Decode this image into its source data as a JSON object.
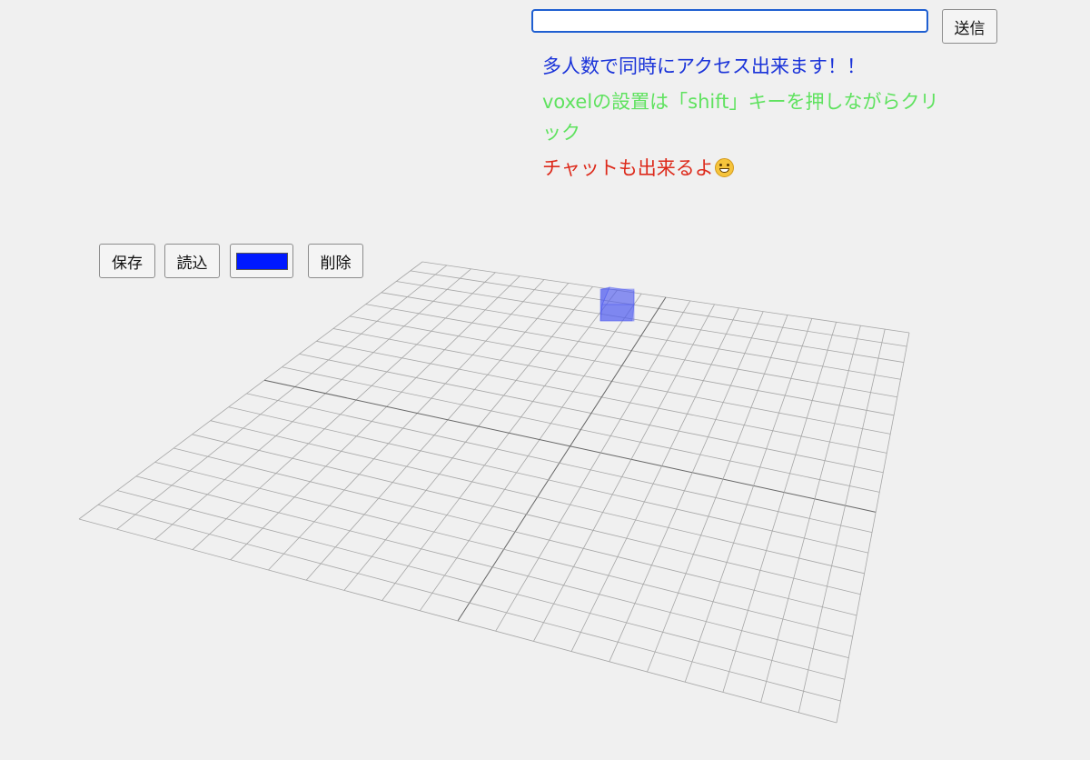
{
  "chat": {
    "input_value": "",
    "send_label": "送信",
    "messages": [
      {
        "text": "多人数で同時にアクセス出来ます！！",
        "color": "#1a33d9"
      },
      {
        "text": "voxelの設置は「shift」キーを押しながらクリック",
        "color": "#5fe25f"
      },
      {
        "text": "チャットも出来るよ",
        "color": "#dd2a1b",
        "icon": "grinning-face-emoji-icon"
      }
    ]
  },
  "toolbar": {
    "save_label": "保存",
    "load_label": "読込",
    "color_value": "#0019ff",
    "delete_label": "削除"
  },
  "scene": {
    "grid_divisions": 20,
    "grid_line_color": "#a6a6a6",
    "grid_center_color": "#666666",
    "voxel_color": "#4f5cf0"
  }
}
